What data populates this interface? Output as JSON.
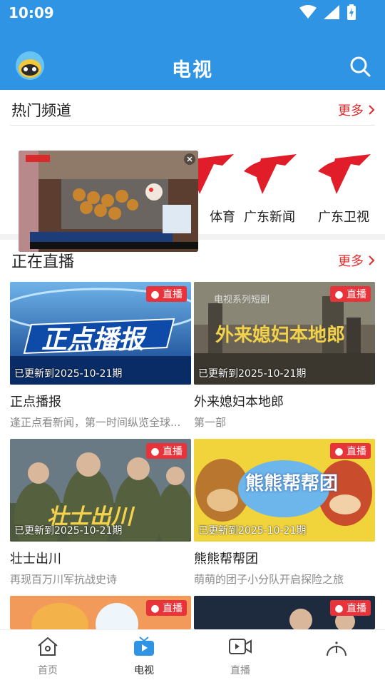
{
  "status_bar": {
    "time": "10:09"
  },
  "header": {
    "title": "电视"
  },
  "hot_channels": {
    "title": "热门频道",
    "more_label": "更多",
    "items": [
      {
        "label": "体育"
      },
      {
        "label": "广东新闻"
      },
      {
        "label": "广东卫视"
      }
    ]
  },
  "live": {
    "title": "正在直播",
    "more_label": "更多",
    "badge": "直播",
    "cards": [
      {
        "title": "正点播报",
        "desc": "逢正点看新闻，第一时间纵览全球...",
        "update": "已更新到2025-10-21期",
        "thumb_text": "正点播报"
      },
      {
        "title": "外来媳妇本地郎",
        "desc": "第一部",
        "update": "已更新到2025-10-21期",
        "thumb_text": "外来媳妇本地郎"
      },
      {
        "title": "壮士出川",
        "desc": "再现百万川军抗战史诗",
        "update": "已更新到2025-10-21期",
        "thumb_text": "壮士出川"
      },
      {
        "title": "熊熊帮帮团",
        "desc": "萌萌的团子小分队开启探险之旅",
        "update": "已更新到2025-10-21期",
        "thumb_text": "熊熊帮帮团"
      },
      {
        "badge": "直播"
      },
      {
        "badge": "直播"
      }
    ]
  },
  "bottom_nav": {
    "items": [
      {
        "label": "首页",
        "icon": "home-icon"
      },
      {
        "label": "电视",
        "icon": "tv-icon"
      },
      {
        "label": "直播",
        "icon": "video-icon"
      },
      {
        "label": "",
        "icon": "info-icon"
      }
    ]
  },
  "colors": {
    "primary": "#2f94e4",
    "accent_red": "#e02b2b",
    "badge_red": "#e8333b"
  }
}
